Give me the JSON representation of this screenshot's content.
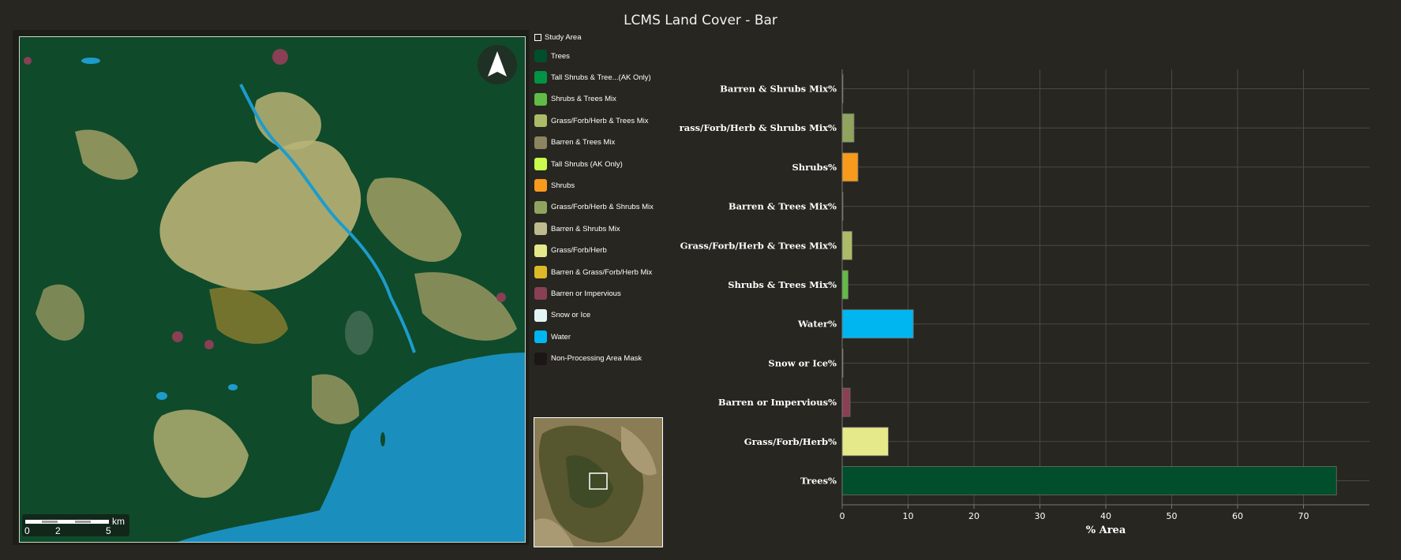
{
  "title": "LCMS Land Cover - Bar",
  "legend": {
    "study_area": "Study Area",
    "items": [
      {
        "label": "Trees",
        "color": "#004e2b"
      },
      {
        "label": "Tall Shrubs & Tree...(AK Only)",
        "color": "#009344"
      },
      {
        "label": "Shrubs & Trees Mix",
        "color": "#61bb46"
      },
      {
        "label": "Grass/Forb/Herb & Trees Mix",
        "color": "#acbb67"
      },
      {
        "label": "Barren & Trees Mix",
        "color": "#8b8560"
      },
      {
        "label": "Tall Shrubs (AK Only)",
        "color": "#cafd4b"
      },
      {
        "label": "Shrubs",
        "color": "#f89a1c"
      },
      {
        "label": "Grass/Forb/Herb & Shrubs Mix",
        "color": "#8fa55f"
      },
      {
        "label": "Barren & Shrubs Mix",
        "color": "#bebb8e"
      },
      {
        "label": "Grass/Forb/Herb",
        "color": "#e5e98a"
      },
      {
        "label": "Barren & Grass/Forb/Herb Mix",
        "color": "#ddb925"
      },
      {
        "label": "Barren or Impervious",
        "color": "#893f54"
      },
      {
        "label": "Snow or Ice",
        "color": "#e3f4f5"
      },
      {
        "label": "Water",
        "color": "#00b6f0"
      },
      {
        "label": "Non-Processing Area Mask",
        "color": "#1b1716"
      }
    ]
  },
  "scale_bar": {
    "unit": "km",
    "ticks": [
      "0",
      "2",
      "5"
    ]
  },
  "chart_data": {
    "type": "bar",
    "orientation": "horizontal",
    "categories": [
      "Barren & Shrubs Mix%",
      "Grass/Forb/Herb & Shrubs Mix%",
      "Shrubs%",
      "Barren & Trees Mix%",
      "Grass/Forb/Herb & Trees Mix%",
      "Shrubs & Trees Mix%",
      "Water%",
      "Snow or Ice%",
      "Barren or Impervious%",
      "Grass/Forb/Herb%",
      "Trees%"
    ],
    "values": [
      0.1,
      1.8,
      2.4,
      0.1,
      1.5,
      0.9,
      10.8,
      0.05,
      1.2,
      7.0,
      75.0
    ],
    "colors": [
      "#bebb8e",
      "#8fa55f",
      "#f89a1c",
      "#8b8560",
      "#acbb67",
      "#61bb46",
      "#00b6f0",
      "#e3f4f5",
      "#893f54",
      "#e5e98a",
      "#004e2b"
    ],
    "xlabel": "% Area",
    "ylabel": "",
    "xlim": [
      0,
      80
    ],
    "xticks": [
      0,
      10,
      20,
      30,
      40,
      50,
      60,
      70
    ],
    "grid": true
  }
}
